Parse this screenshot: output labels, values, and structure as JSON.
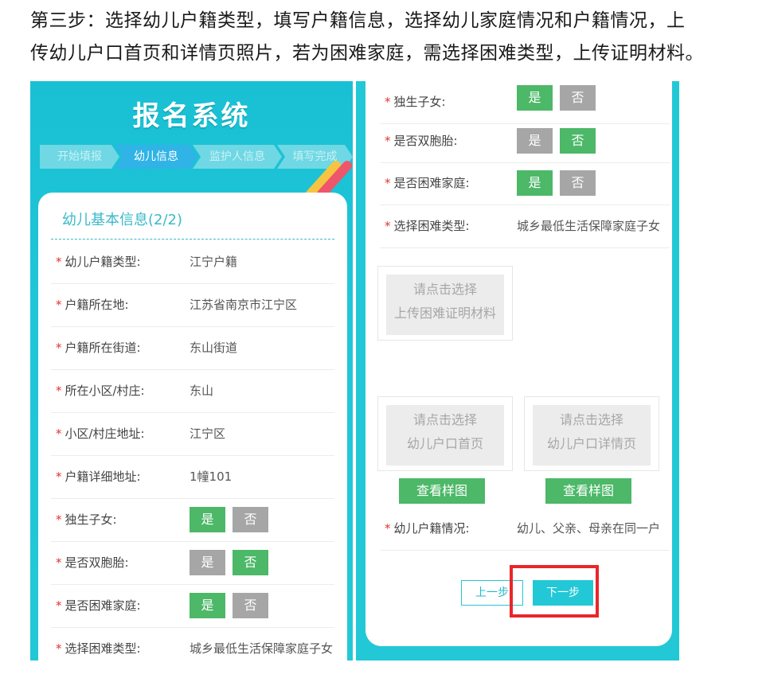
{
  "instruction": {
    "line1": "第三步：选择幼儿户籍类型，填写户籍信息，选择幼儿家庭情况和户籍情况，上",
    "line2": "传幼儿户口首页和详情页照片，若为困难家庭，需选择困难类型，上传证明材料。"
  },
  "app": {
    "title": "报名系统",
    "steps": [
      "开始填报",
      "幼儿信息",
      "监护人信息",
      "填写完成"
    ],
    "active_step": "幼儿信息"
  },
  "section_title": "幼儿基本信息(2/2)",
  "required_mark": "*",
  "toggle_yes": "是",
  "toggle_no": "否",
  "left_fields": [
    {
      "label": "幼儿户籍类型:",
      "value": "江宁户籍"
    },
    {
      "label": "户籍所在地:",
      "value": "江苏省南京市江宁区"
    },
    {
      "label": "户籍所在街道:",
      "value": "东山街道"
    },
    {
      "label": "所在小区/村庄:",
      "value": "东山"
    },
    {
      "label": "小区/村庄地址:",
      "value": "江宁区"
    },
    {
      "label": "户籍详细地址:",
      "value": "1幢101"
    }
  ],
  "toggle_fields": [
    {
      "label": "独生子女:",
      "selected": "是"
    },
    {
      "label": "是否双胞胎:",
      "selected": "否"
    },
    {
      "label": "是否困难家庭:",
      "selected": "是"
    }
  ],
  "hardship_type": {
    "label": "选择困难类型:",
    "value": "城乡最低生活保障家庭子女"
  },
  "upload": {
    "hardship": {
      "line1": "请点击选择",
      "line2": "上传困难证明材料"
    },
    "hukou_home": {
      "line1": "请点击选择",
      "line2": "幼儿户口首页"
    },
    "hukou_detail": {
      "line1": "请点击选择",
      "line2": "幼儿户口详情页"
    }
  },
  "sample_button": "查看样图",
  "hukou_status": {
    "label": "幼儿户籍情况:",
    "value": "幼儿、父亲、母亲在同一户"
  },
  "nav": {
    "prev": "上一步",
    "next": "下一步"
  },
  "colors": {
    "teal": "#22c8d6",
    "green": "#4cb868",
    "gray": "#a6a6a6",
    "red_highlight": "#e8262a",
    "required": "#e23333"
  }
}
